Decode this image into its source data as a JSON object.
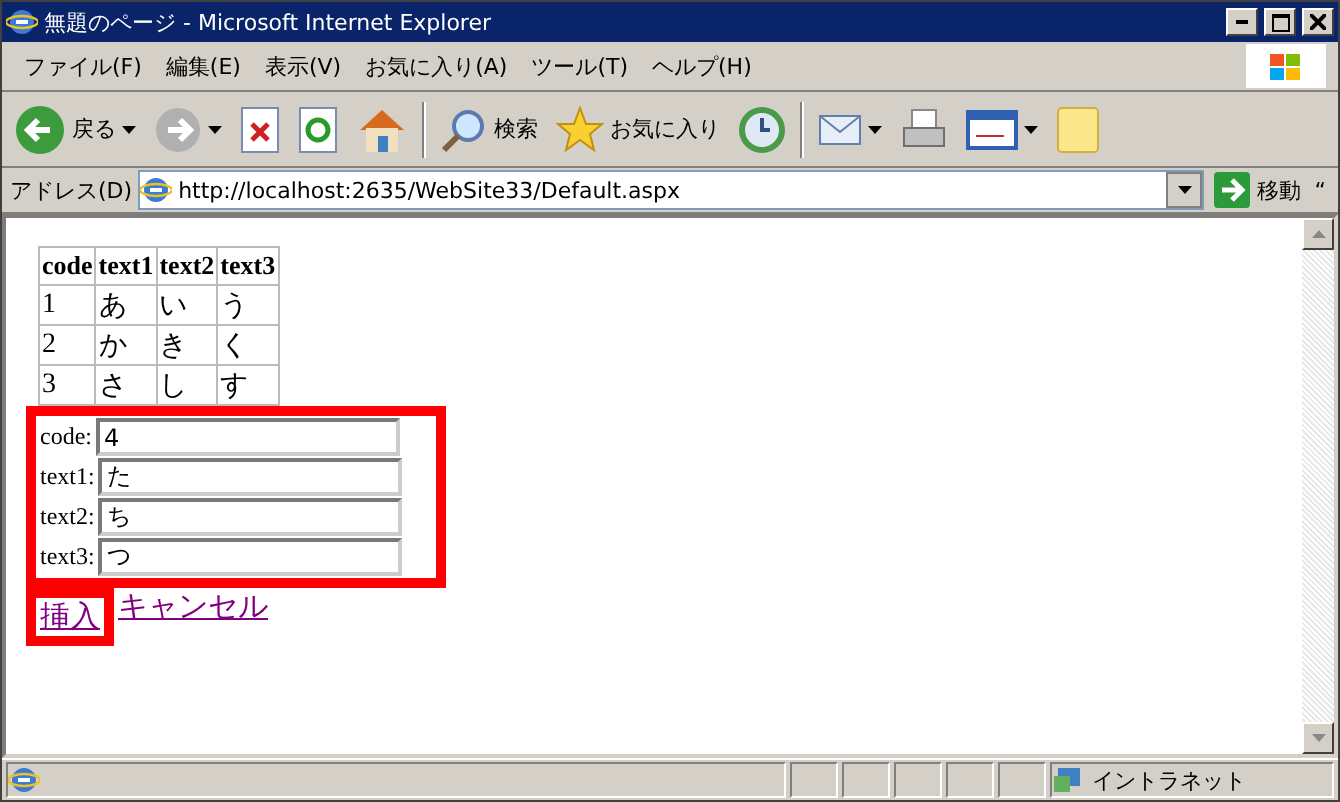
{
  "window": {
    "title": "無題のページ - Microsoft Internet Explorer"
  },
  "menu": [
    "ファイル(F)",
    "編集(E)",
    "表示(V)",
    "お気に入り(A)",
    "ツール(T)",
    "ヘルプ(H)"
  ],
  "toolbar": {
    "back": "戻る",
    "search": "検索",
    "favorites": "お気に入り"
  },
  "address": {
    "label": "アドレス(D)",
    "value": "http://localhost:2635/WebSite33/Default.aspx",
    "go": "移動",
    "more": "“"
  },
  "table": {
    "columns": [
      "code",
      "text1",
      "text2",
      "text3"
    ],
    "rows": [
      [
        "1",
        "あ",
        "い",
        "う"
      ],
      [
        "2",
        "か",
        "き",
        "く"
      ],
      [
        "3",
        "さ",
        "し",
        "す"
      ]
    ]
  },
  "form": [
    {
      "label": "code:",
      "value": "4"
    },
    {
      "label": "text1:",
      "value": "た"
    },
    {
      "label": "text2:",
      "value": "ち"
    },
    {
      "label": "text3:",
      "value": "つ"
    }
  ],
  "links": [
    "挿入",
    "キャンセル"
  ],
  "status_bar": {
    "zone": "イントラネット"
  }
}
